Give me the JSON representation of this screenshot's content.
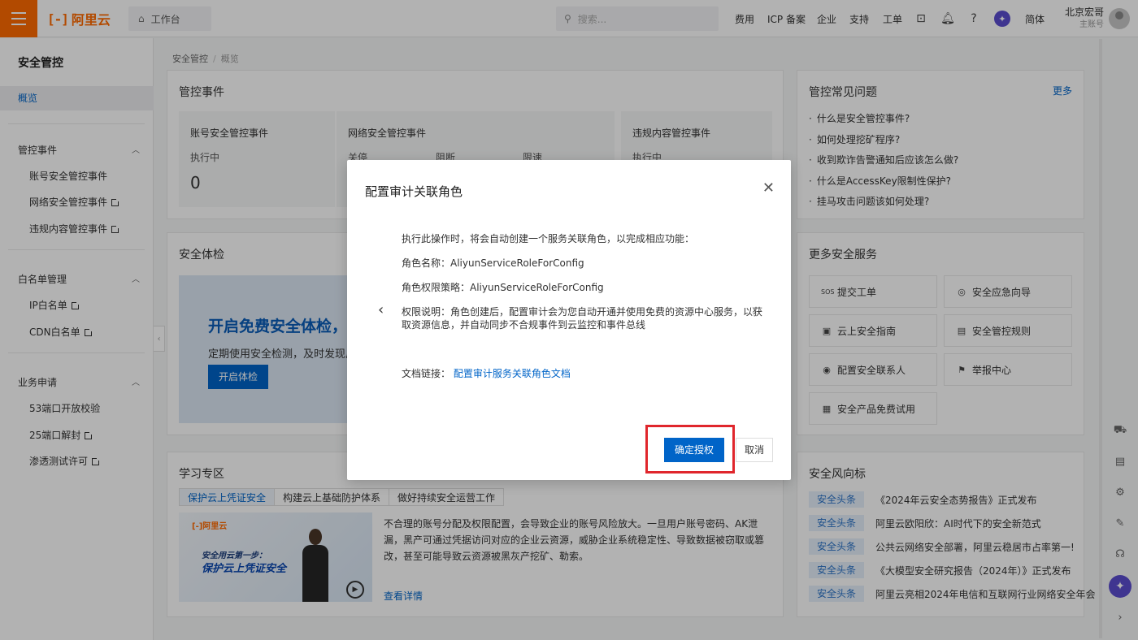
{
  "topbar": {
    "logo": "阿里云",
    "workbench": "工作台",
    "search_placeholder": "搜索...",
    "nav": [
      "费用",
      "ICP 备案",
      "企业",
      "支持",
      "工单"
    ],
    "lang": "简体",
    "user_name": "北京宏哥",
    "user_role": "主账号"
  },
  "sidebar": {
    "title": "安全管控",
    "active": "概览",
    "groups": [
      {
        "label": "管控事件",
        "items": [
          "账号安全管控事件",
          "网络安全管控事件",
          "违规内容管控事件"
        ]
      },
      {
        "label": "白名单管理",
        "items": [
          "IP白名单",
          "CDN白名单"
        ]
      },
      {
        "label": "业务申请",
        "items": [
          "53端口开放校验",
          "25端口解封",
          "渗透测试许可"
        ]
      }
    ]
  },
  "breadcrumb": [
    "安全管控",
    "概览"
  ],
  "events": {
    "title": "管控事件",
    "account": {
      "title": "账号安全管控事件",
      "label": "执行中",
      "value": "0"
    },
    "network": {
      "title": "网络安全管控事件",
      "labels": [
        "关停",
        "阻断",
        "限速"
      ]
    },
    "content": {
      "title": "违规内容管控事件",
      "label": "执行中"
    }
  },
  "check": {
    "title": "安全体检",
    "banner_title": "开启免费安全体检，查",
    "banner_desc": "定期使用安全检测，及时发现风",
    "button": "开启体检"
  },
  "learn": {
    "title": "学习专区",
    "tabs": [
      "保护云上凭证安全",
      "构建云上基础防护体系",
      "做好持续安全运营工作"
    ],
    "video_logo": "[-]阿里云",
    "video_line1": "安全用云第一步：",
    "video_line2": "保护云上凭证安全",
    "text": "不合理的账号分配及权限配置，会导致企业的账号风险放大。一旦用户账号密码、AK泄漏，黑产可通过凭据访问对应的企业云资源，威胁企业系统稳定性、导致数据被窃取或篡改，甚至可能导致云资源被黑灰产挖矿、勒索。",
    "more": "查看详情"
  },
  "faq": {
    "title": "管控常见问题",
    "more": "更多",
    "items": [
      "什么是安全管控事件?",
      "如何处理挖矿程序?",
      "收到欺诈告警通知后应该怎么做?",
      "什么是AccessKey限制性保护?",
      "挂马攻击问题该如何处理?"
    ]
  },
  "services": {
    "title": "更多安全服务",
    "items": [
      {
        "label": "提交工单",
        "icon": "sos-icon"
      },
      {
        "label": "安全应急向导",
        "icon": "compass-icon"
      },
      {
        "label": "云上安全指南",
        "icon": "image-icon"
      },
      {
        "label": "安全管控规则",
        "icon": "document-icon"
      },
      {
        "label": "配置安全联系人",
        "icon": "contact-icon"
      },
      {
        "label": "举报中心",
        "icon": "report-icon"
      },
      {
        "label": "安全产品免费试用",
        "icon": "gift-icon"
      }
    ]
  },
  "news": {
    "title": "安全风向标",
    "tag": "安全头条",
    "items": [
      "《2024年云安全态势报告》正式发布",
      "阿里云欧阳欣：AI时代下的安全新范式",
      "公共云网络安全部署，阿里云稳居市占率第一!",
      "《大模型安全研究报告（2024年）》正式发布",
      "阿里云亮相2024年电信和互联网行业网络安全年会"
    ]
  },
  "modal": {
    "title": "配置审计关联角色",
    "intro": "执行此操作时，将会自动创建一个服务关联角色，以完成相应功能：",
    "role_name": "角色名称：AliyunServiceRoleForConfig",
    "role_policy": "角色权限策略：AliyunServiceRoleForConfig",
    "perm_line1": "权限说明：角色创建后，配置审计会为您自动开通并使用免费的资源中心服务，以获",
    "perm_line2": "取资源信息，并自动同步不合规事件到云监控和事件总线",
    "doc_label": "文档链接：",
    "doc_link": "配置审计服务关联角色文档",
    "ok": "确定授权",
    "cancel": "取消"
  },
  "colors": {
    "brand": "#ff6a00",
    "primary": "#0064c8",
    "highlight": "#e0262c"
  }
}
